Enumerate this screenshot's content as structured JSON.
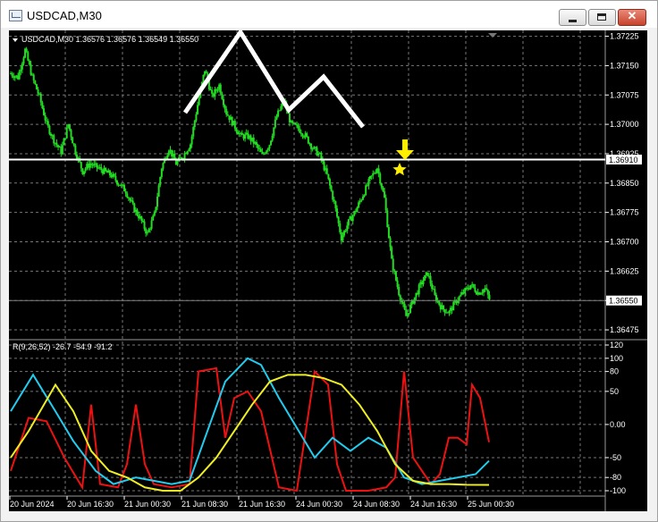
{
  "window": {
    "title": "USDCAD,M30",
    "buttons": {
      "minimize": "minimize",
      "maximize": "maximize",
      "close": "✕"
    }
  },
  "chart": {
    "info_line": "USDCAD,M30  1.36576 1.36576 1.36549 1.36550",
    "indicator_line": "R(9,26,52) -26.7 -54.9 -91.2",
    "current_price_label": "1.36550",
    "marked_level_label": "1.36910",
    "colors": {
      "price": "#22dd22",
      "fast": "#ee1111",
      "mid": "#22ccee",
      "slow": "#eeee22",
      "marker": "#ffee00",
      "pattern": "#ffffff",
      "grid": "#777777"
    }
  },
  "chart_data": {
    "type": "candlestick",
    "symbol": "USDCAD",
    "timeframe": "M30",
    "ohlc_last": {
      "open": 1.36576,
      "high": 1.36576,
      "low": 1.36549,
      "close": 1.3655
    },
    "price_axis": {
      "ticks": [
        "1.37225",
        "1.37150",
        "1.37075",
        "1.37000",
        "1.36925",
        "1.36850",
        "1.36775",
        "1.36700",
        "1.36625",
        "1.36550",
        "1.36475"
      ],
      "range": [
        1.3645,
        1.3724
      ]
    },
    "time_axis": [
      "20 Jun 2024",
      "20 Jun 16:30",
      "21 Jun 00:30",
      "21 Jun 08:30",
      "21 Jun 16:30",
      "24 Jun 00:30",
      "24 Jun 08:30",
      "24 Jun 16:30",
      "25 Jun 00:30"
    ],
    "horizontal_level": 1.3691,
    "price_path": [
      [
        0,
        1.3713
      ],
      [
        6,
        1.3712
      ],
      [
        12,
        1.3719
      ],
      [
        18,
        1.3712
      ],
      [
        24,
        1.3707
      ],
      [
        30,
        1.37
      ],
      [
        36,
        1.3696
      ],
      [
        42,
        1.3693
      ],
      [
        48,
        1.37
      ],
      [
        54,
        1.3693
      ],
      [
        60,
        1.3688
      ],
      [
        66,
        1.369
      ],
      [
        72,
        1.3689
      ],
      [
        78,
        1.3688
      ],
      [
        84,
        1.3687
      ],
      [
        90,
        1.3685
      ],
      [
        96,
        1.3683
      ],
      [
        102,
        1.3679
      ],
      [
        108,
        1.3676
      ],
      [
        114,
        1.3672
      ],
      [
        120,
        1.3677
      ],
      [
        126,
        1.3689
      ],
      [
        132,
        1.3694
      ],
      [
        138,
        1.369
      ],
      [
        144,
        1.3692
      ],
      [
        150,
        1.3695
      ],
      [
        156,
        1.3705
      ],
      [
        162,
        1.3714
      ],
      [
        168,
        1.3707
      ],
      [
        174,
        1.371
      ],
      [
        180,
        1.3703
      ],
      [
        186,
        1.37
      ],
      [
        192,
        1.3697
      ],
      [
        198,
        1.3697
      ],
      [
        204,
        1.3695
      ],
      [
        210,
        1.3692
      ],
      [
        216,
        1.3695
      ],
      [
        222,
        1.3702
      ],
      [
        228,
        1.3706
      ],
      [
        234,
        1.37
      ],
      [
        240,
        1.3699
      ],
      [
        246,
        1.3697
      ],
      [
        252,
        1.3694
      ],
      [
        258,
        1.3692
      ],
      [
        264,
        1.3687
      ],
      [
        270,
        1.368
      ],
      [
        276,
        1.3671
      ],
      [
        282,
        1.3675
      ],
      [
        288,
        1.3678
      ],
      [
        294,
        1.3682
      ],
      [
        300,
        1.3686
      ],
      [
        306,
        1.3689
      ],
      [
        312,
        1.3681
      ],
      [
        318,
        1.3665
      ],
      [
        324,
        1.3657
      ],
      [
        330,
        1.3651
      ],
      [
        336,
        1.3655
      ],
      [
        342,
        1.3659
      ],
      [
        348,
        1.3662
      ],
      [
        354,
        1.3656
      ],
      [
        360,
        1.3653
      ],
      [
        366,
        1.3652
      ],
      [
        372,
        1.3655
      ],
      [
        378,
        1.3657
      ],
      [
        384,
        1.3659
      ],
      [
        390,
        1.3657
      ],
      [
        396,
        1.3658
      ],
      [
        400,
        1.3655
      ]
    ],
    "indicator": {
      "name": "R(9,26,52)",
      "axis_ticks": [
        "120",
        "100",
        "80",
        "50",
        "0.00",
        "-50",
        "-80",
        "-100"
      ],
      "range": [
        -100,
        120
      ],
      "series": [
        {
          "values": [
            -26.7
          ]
        },
        {
          "values": [
            -54.9
          ]
        },
        {
          "values": [
            -91.2
          ]
        }
      ]
    }
  }
}
